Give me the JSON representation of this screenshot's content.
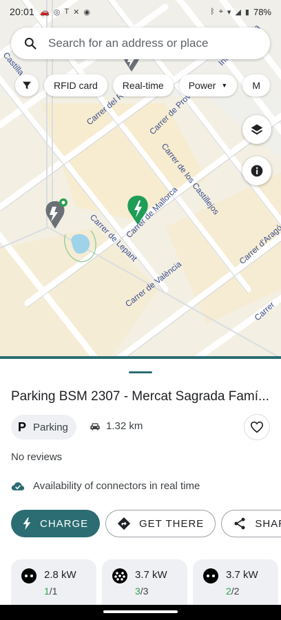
{
  "status_bar": {
    "time": "20:01",
    "battery": "78%"
  },
  "search": {
    "placeholder": "Search for an address or place"
  },
  "filters": {
    "chips": [
      "RFID card",
      "Real-time",
      "Power",
      "M"
    ]
  },
  "map": {
    "streets": [
      "Carrer de Mallorca",
      "Carrer de Lepant",
      "Carrer de València",
      "Carrer de los Castillejos",
      "Carrer de Provença",
      "Carrer del Rosselló",
      "Carrer d'Aragó",
      "Independencia",
      "Castilla",
      "Carrer"
    ]
  },
  "place": {
    "title": "Parking BSM 2307 - Mercat Sagrada Famí...",
    "type_label": "Parking",
    "type_icon": "P",
    "distance": "1.32 km",
    "reviews": "No reviews",
    "availability_text": "Availability of connectors in real time"
  },
  "actions": {
    "charge": "CHARGE",
    "get_there": "GET THERE",
    "share": "SHARE"
  },
  "connectors": [
    {
      "power": "2.8 kW",
      "available": "1",
      "total": "/1",
      "icon": "schuko-plug-icon"
    },
    {
      "power": "3.7 kW",
      "available": "3",
      "total": "/3",
      "icon": "type2-plug-icon"
    },
    {
      "power": "3.7 kW",
      "available": "2",
      "total": "/2",
      "icon": "schuko-plug-icon"
    }
  ],
  "colors": {
    "primary": "#2b6d72",
    "available": "#2e9e4f",
    "map_land": "#f3efe3",
    "map_road": "#ffffff",
    "street_label": "#3d4f8a",
    "pin_green": "#1f9d57",
    "pin_gray": "#6b7077"
  }
}
